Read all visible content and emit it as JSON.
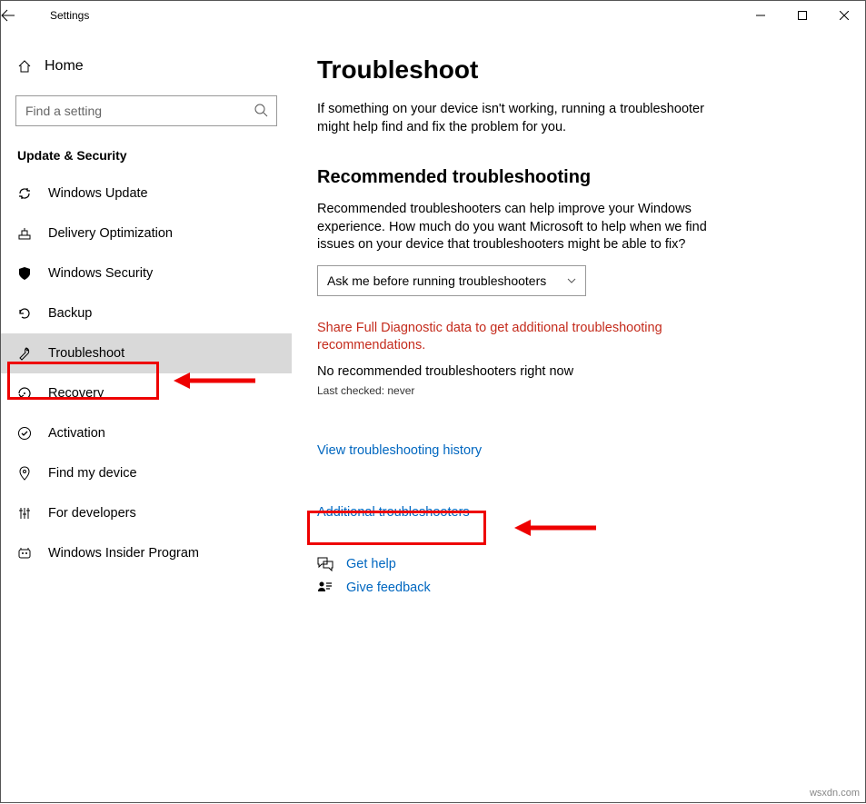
{
  "window": {
    "title": "Settings"
  },
  "sidebar": {
    "home": "Home",
    "search_placeholder": "Find a setting",
    "section": "Update & Security",
    "items": [
      {
        "label": "Windows Update"
      },
      {
        "label": "Delivery Optimization"
      },
      {
        "label": "Windows Security"
      },
      {
        "label": "Backup"
      },
      {
        "label": "Troubleshoot"
      },
      {
        "label": "Recovery"
      },
      {
        "label": "Activation"
      },
      {
        "label": "Find my device"
      },
      {
        "label": "For developers"
      },
      {
        "label": "Windows Insider Program"
      }
    ]
  },
  "content": {
    "title": "Troubleshoot",
    "intro": "If something on your device isn't working, running a troubleshooter might help find and fix the problem for you.",
    "rec_heading": "Recommended troubleshooting",
    "rec_desc": "Recommended troubleshooters can help improve your Windows experience. How much do you want Microsoft to help when we find issues on your device that troubleshooters might be able to fix?",
    "dropdown_value": "Ask me before running troubleshooters",
    "warning": "Share Full Diagnostic data to get additional troubleshooting recommendations.",
    "no_rec": "No recommended troubleshooters right now",
    "last_checked": "Last checked: never",
    "history_link": "View troubleshooting history",
    "additional_link": "Additional troubleshooters",
    "get_help": "Get help",
    "give_feedback": "Give feedback"
  },
  "watermark": "wsxdn.com"
}
